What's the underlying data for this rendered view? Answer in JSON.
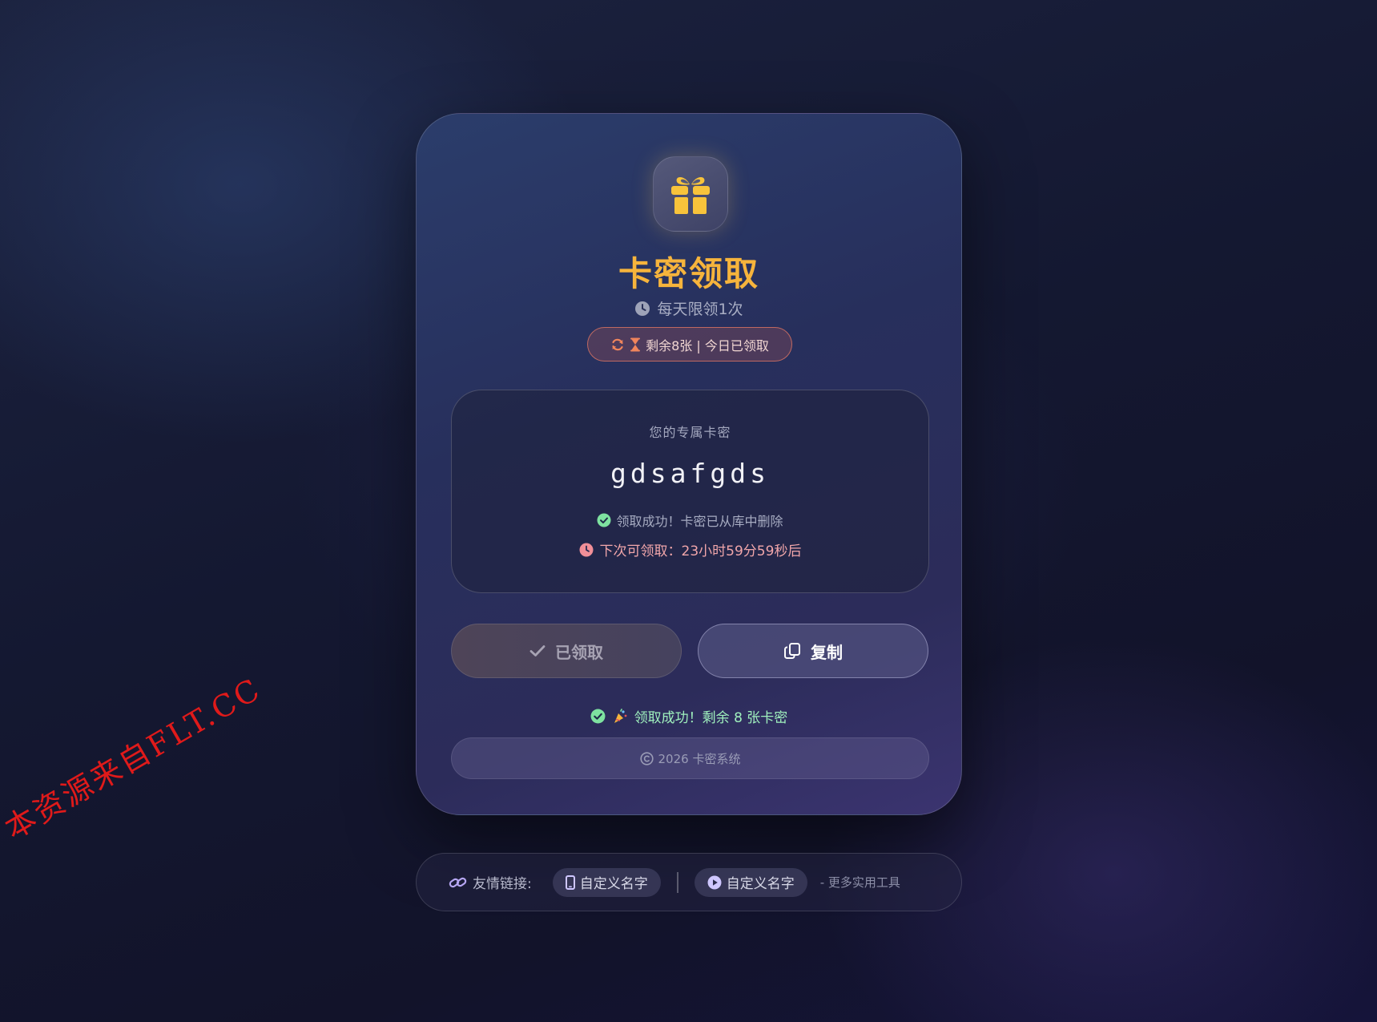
{
  "card": {
    "icon": "gift-icon",
    "title": "卡密领取",
    "subtitle": "每天限领1次",
    "subtitle_icon": "clock-icon",
    "status": "剩余8张 | 今日已领取",
    "status_icons": [
      "refresh-icon",
      "hourglass-icon"
    ]
  },
  "code": {
    "label": "您的专属卡密",
    "value": "gdsafgds",
    "success": "领取成功！卡密已从库中删除",
    "next_label": "下次可领取：",
    "next_countdown": "23小时59分59秒后"
  },
  "buttons": {
    "claimed_label": "已领取",
    "copy_label": "复制"
  },
  "result": {
    "message": "领取成功！剩余 8 张卡密"
  },
  "footer": {
    "text": "2026 卡密系统"
  },
  "links": {
    "label": "友情链接:",
    "items": [
      {
        "icon": "mobile-icon",
        "label": "自定义名字"
      },
      {
        "icon": "play-icon",
        "label": "自定义名字"
      }
    ],
    "more": "- 更多实用工具"
  },
  "watermark": "本资源来自FLT.CC",
  "colors": {
    "accent": "#f6b43c",
    "success": "#9ff0bd",
    "countdown": "#f1a6aa",
    "status_border": "#e67864"
  }
}
